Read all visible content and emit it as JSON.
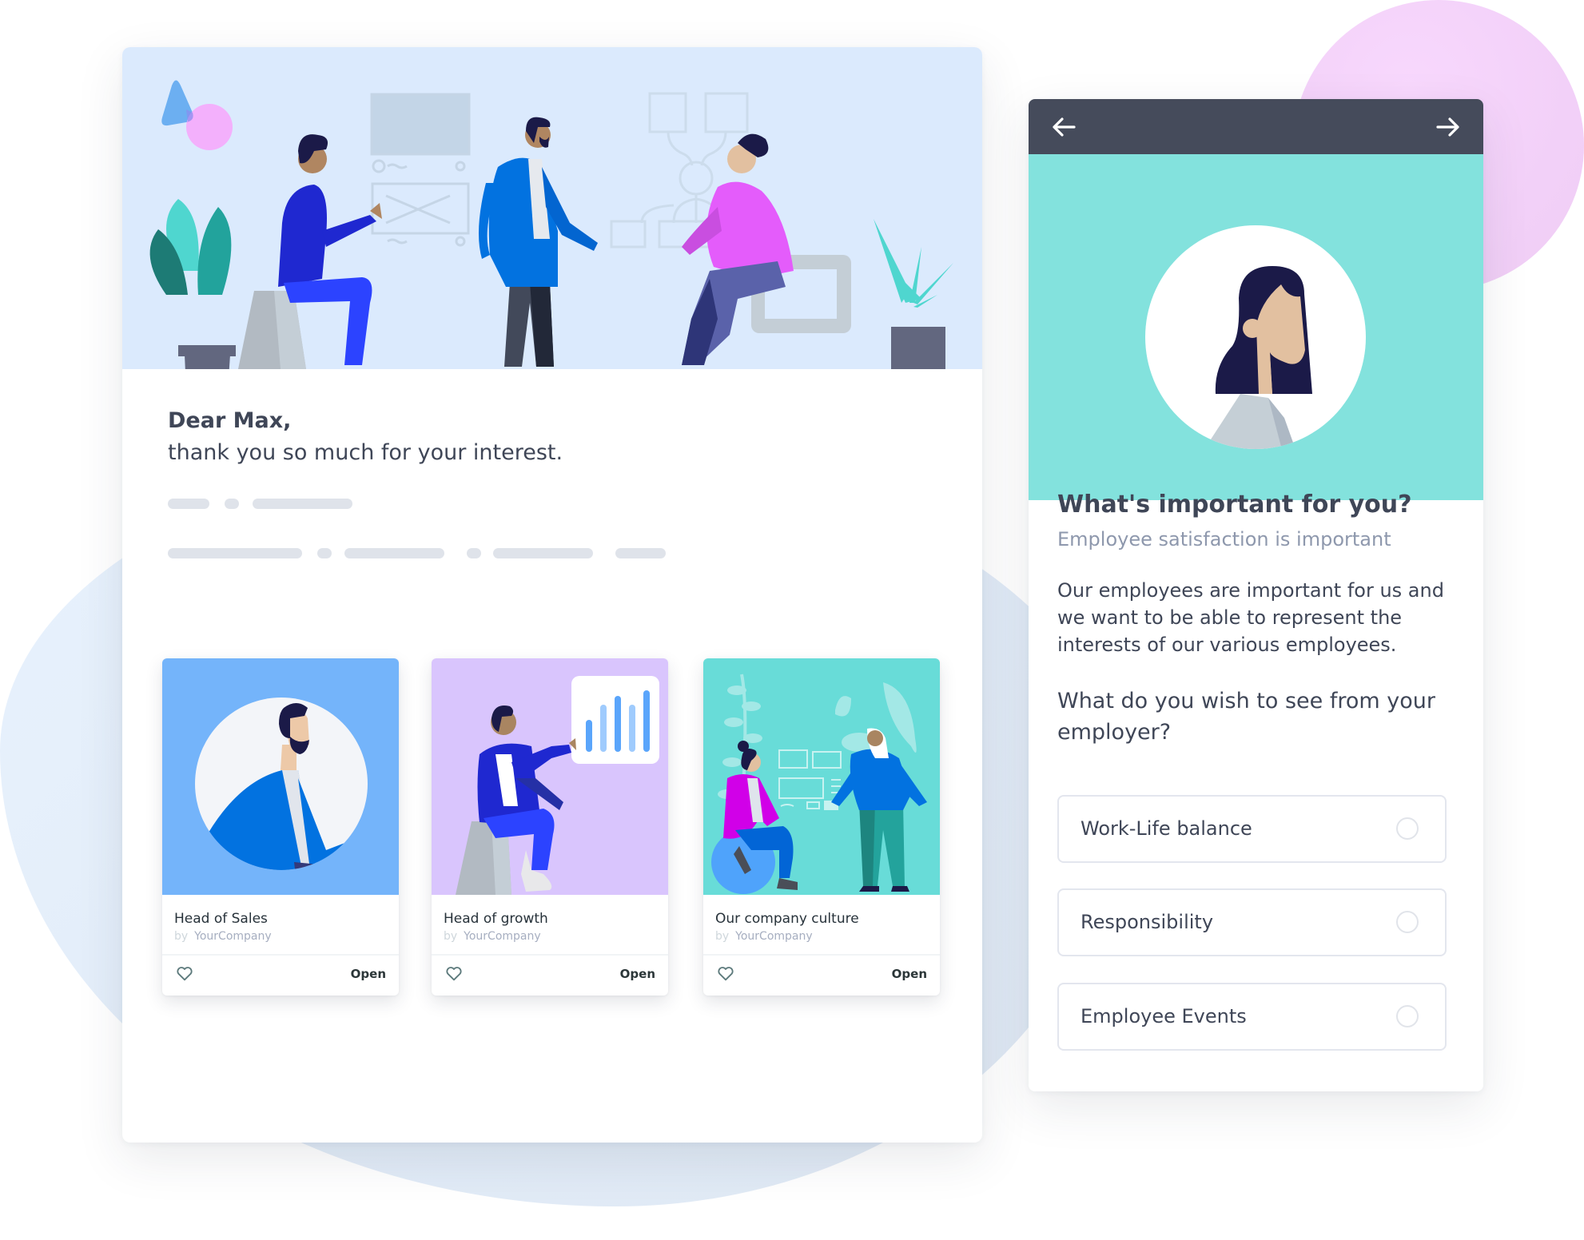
{
  "colors": {
    "hero_bg": "#dbeafd",
    "survey_nav_bg": "#454b5b",
    "survey_hero_bg": "#83e2dd",
    "card1_bg": "#74b4fa",
    "card2_bg": "#d9c5fd",
    "card3_bg": "#68dcd8",
    "text_primary": "#3f4657",
    "text_muted": "#8e98ad"
  },
  "email": {
    "greeting_line1": "Dear Max,",
    "greeting_line2": "thank you so much for your interest."
  },
  "cards": [
    {
      "title": "Head of Sales",
      "by_prefix": "by",
      "author": "YourCompany",
      "action": "Open",
      "illustration": "bearded-man-portrait"
    },
    {
      "title": "Head of growth",
      "by_prefix": "by",
      "author": "YourCompany",
      "action": "Open",
      "illustration": "man-presenting-bar-chart"
    },
    {
      "title": "Our company culture",
      "by_prefix": "by",
      "author": "YourCompany",
      "action": "Open",
      "illustration": "two-women-whiteboard"
    }
  ],
  "survey": {
    "nav": {
      "back_icon": "arrow-left-icon",
      "next_icon": "arrow-right-icon"
    },
    "title": "What's important for you?",
    "subtitle": "Employee satisfaction is important",
    "body": "Our employees are important for us and we want to be able to represent the interests of our various employees.",
    "question": "What do you wish to see from your employer?",
    "options": [
      {
        "label": "Work-Life balance",
        "selected": false
      },
      {
        "label": "Responsibility",
        "selected": false
      },
      {
        "label": "Employee Events",
        "selected": false
      }
    ]
  }
}
